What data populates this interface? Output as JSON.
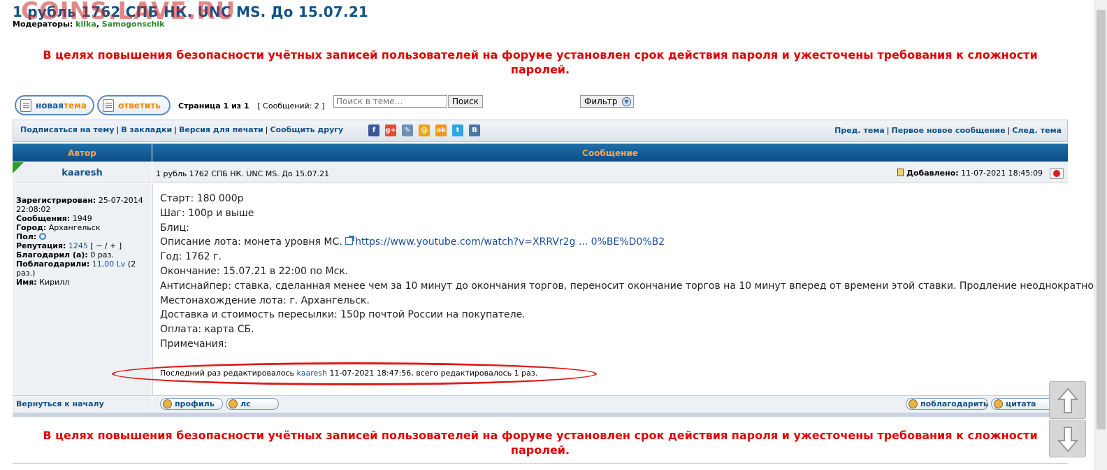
{
  "topic": {
    "title": "1 рубль 1762 СПБ НК. UNC MS. До 15.07.21",
    "watermark": "COINS.LAVE.RU",
    "moderators_label": "Модераторы:",
    "moderators": [
      "kilka",
      "Samogonschik"
    ]
  },
  "notice": "В целях повышения безопасности учётных записей пользователей на форуме установлен срок действия пароля и ужесточены требования к сложности паролей.",
  "actions": {
    "new_topic_a": "новая ",
    "new_topic_b": "тема",
    "reply": "ответить",
    "pagination": "Страница 1 из 1",
    "message_count": "[ Сообщений: 2 ]",
    "search_placeholder": "Поиск в теме…",
    "search_button": "Поиск",
    "filter_button": "Фильтр"
  },
  "linkbar": {
    "left": [
      "Подписаться на тему",
      "В закладки",
      "Версия для печати",
      "Сообщить другу"
    ],
    "right": [
      "Пред. тема",
      "Первое новое сообщение",
      "След. тема"
    ],
    "social": [
      {
        "icon": "facebook-icon",
        "glyph": "f",
        "color": "#3b5998"
      },
      {
        "icon": "google-plus-icon",
        "glyph": "g+",
        "color": "#dd4b39"
      },
      {
        "icon": "livejournal-icon",
        "glyph": "✎",
        "color": "#6c8fb5"
      },
      {
        "icon": "mailru-icon",
        "glyph": "@",
        "color": "#f0a30a"
      },
      {
        "icon": "odnoklassniki-icon",
        "glyph": "ok",
        "color": "#f7931e"
      },
      {
        "icon": "twitter-icon",
        "glyph": "t",
        "color": "#2ca5e0"
      },
      {
        "icon": "vkontakte-icon",
        "glyph": "B",
        "color": "#4a76a8"
      }
    ]
  },
  "table": {
    "author_header": "Автор",
    "message_header": "Сообщение"
  },
  "post": {
    "author": "kaaresh",
    "subject": "1 рубль 1762 СПБ НК. UNC MS. До 15.07.21",
    "added_label": "Добавлено:",
    "added_time": "11-07-2021 18:45:09",
    "profile": {
      "registered_label": "Зарегистрирован:",
      "registered": "25-07-2014 22:08:02",
      "posts_label": "Сообщения:",
      "posts": "1949",
      "city_label": "Город:",
      "city": "Архангельск",
      "gender_label": "Пол:",
      "rep_label": "Репутация:",
      "rep": "1245",
      "rep_controls": "[ − / + ]",
      "thanked_label": "Благодарил (а):",
      "thanked": "0 раз.",
      "thanked_by_label": "Поблагодарили:",
      "thanked_by": "11,00 Lv",
      "thanked_by_times": "(2 раз.)",
      "name_label": "Имя:",
      "name": "Кирилл"
    },
    "lines": [
      "Старт: 180 000р",
      "Шаг: 100р и выше",
      "Блиц:",
      "Описание лота: монета уровня МС.",
      "Год: 1762 г.",
      "Окончание: 15.07.21 в 22:00 по Мск.",
      "Антиснайпер: ставка, сделанная менее чем за 10 минут до окончания торгов, переносит окончание торгов на 10 минут вперед от времени этой ставки. Продление неоднократное.",
      "Местонахождение лота: г. Архангельск.",
      "Доставка и стоимость пересылки: 150р почтой России на покупателе.",
      "Оплата: карта СБ.",
      "Примечания:"
    ],
    "url": "https://www.youtube.com/watch?v=XRRVr2g ... 0%BE%D0%B2",
    "edit_prefix": "Последний раз редактировалось",
    "edit_user": "kaaresh",
    "edit_suffix": "11-07-2021 18:47:56, всего редактировалось 1 раз."
  },
  "footer": {
    "back_to_top": "Вернуться к началу",
    "profile_btn": "профиль",
    "pm_btn": "лс",
    "thanks_btn": "поблагодарить",
    "quote_btn": "цитата"
  }
}
